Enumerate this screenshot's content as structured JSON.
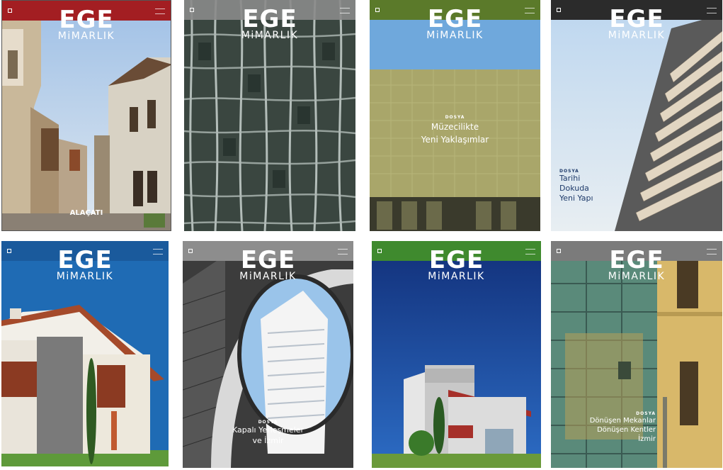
{
  "logo": {
    "main": "EGE",
    "sub": "MiMARLIK"
  },
  "covers": [
    {
      "band_color": "#a31e22",
      "caption": "ALAÇATI"
    },
    {
      "band_color": "#8a8a8a"
    },
    {
      "band_color": "#5b7a2a",
      "dosya": "DOSYA",
      "caption_lines": [
        "Müzecilikte",
        "Yeni Yaklaşımlar"
      ]
    },
    {
      "band_color": "#2b2b2b",
      "dosya": "DOSYA",
      "caption_lines": [
        "Tarihi",
        "Dokuda",
        "Yeni Yapı"
      ]
    },
    {
      "band_color": "#1a5a9c"
    },
    {
      "band_color": "#8d8d8d",
      "dosya": "DOSYA",
      "caption_lines": [
        "Kapalı Yerleşmeler",
        "ve İzmir"
      ]
    },
    {
      "band_color": "#3f8a2e"
    },
    {
      "band_color": "#7b7b7b",
      "dosya": "DOSYA",
      "caption_lines": [
        "Dönüşen Mekanlar",
        "Dönüşen Kentler",
        "İzmir"
      ]
    }
  ]
}
